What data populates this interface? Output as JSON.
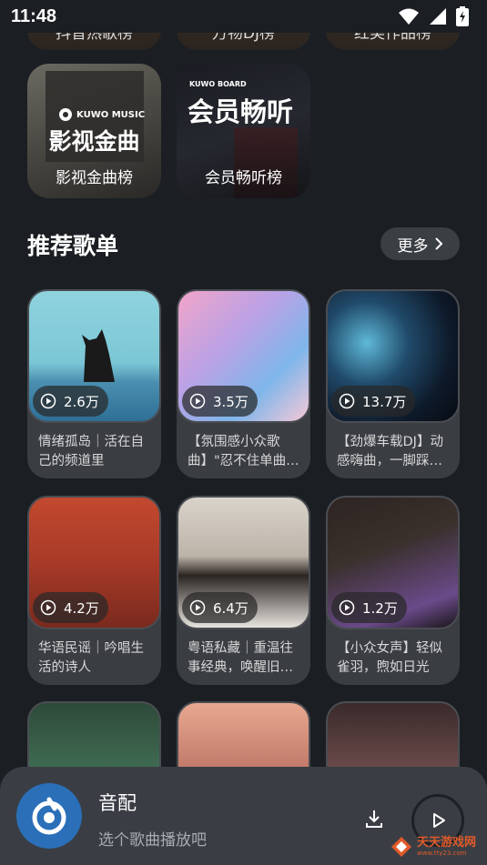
{
  "status_bar": {
    "time": "11:48"
  },
  "charts": {
    "cut_labels": [
      "抖音热歌榜",
      "万物DJ榜",
      "红美作品榜"
    ],
    "items": [
      {
        "label": "影视金曲榜",
        "brand": "KUWO MUSIC",
        "cover_text": "影视金曲"
      },
      {
        "label": "会员畅听榜",
        "brand": "KUWO BOARD",
        "cover_text": "会员畅听"
      }
    ]
  },
  "section": {
    "title": "推荐歌单",
    "more_label": "更多"
  },
  "playlists": [
    {
      "count": "2.6万",
      "title": "情绪孤岛｜活在自己的频道里"
    },
    {
      "count": "3.5万",
      "title": "【氛围感小众歌曲】\"忍不住单曲…"
    },
    {
      "count": "13.7万",
      "title": "【劲爆车载DJ】动感嗨曲，一脚踩…"
    },
    {
      "count": "4.2万",
      "title": "华语民谣｜吟唱生活的诗人"
    },
    {
      "count": "6.4万",
      "title": "粤语私藏｜重温往事经典，唤醒旧…"
    },
    {
      "count": "1.2万",
      "title": "【小众女声】轻似雀羽，煦如日光"
    }
  ],
  "player": {
    "title": "音配",
    "subtitle": "选个歌曲播放吧"
  },
  "watermark": {
    "text": "天天游戏网",
    "url": "www.tty23.com"
  }
}
